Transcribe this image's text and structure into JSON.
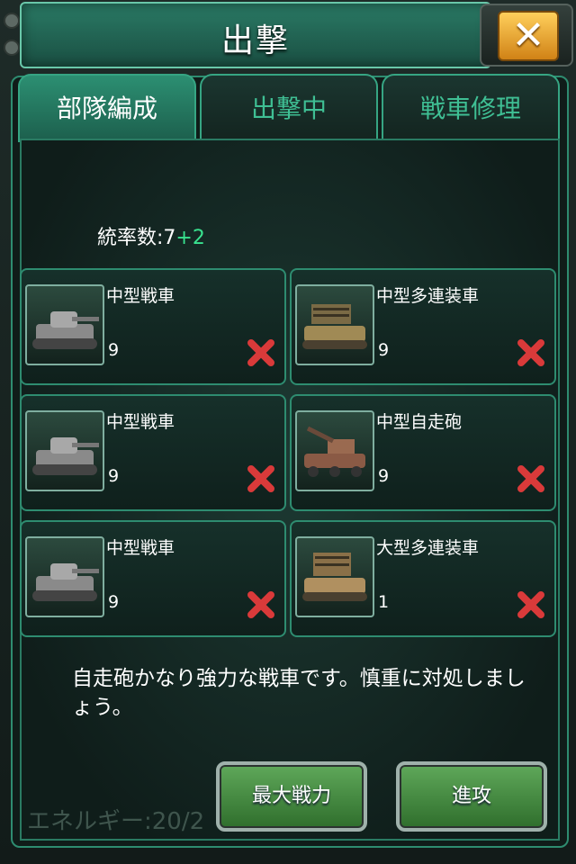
{
  "title": "出撃",
  "tabs": [
    {
      "label": "部隊編成",
      "active": true
    },
    {
      "label": "出撃中",
      "active": false
    },
    {
      "label": "戦車修理",
      "active": false
    }
  ],
  "leadership": {
    "label": "統率数:7",
    "bonus": "+2"
  },
  "units": [
    {
      "name": "中型戦車",
      "count": "9",
      "icon": "medium-tank-icon"
    },
    {
      "name": "中型多連装車",
      "count": "9",
      "icon": "rocket-launcher-vehicle-icon"
    },
    {
      "name": "中型戦車",
      "count": "9",
      "icon": "medium-tank-icon"
    },
    {
      "name": "中型自走砲",
      "count": "9",
      "icon": "self-propelled-gun-icon"
    },
    {
      "name": "中型戦車",
      "count": "9",
      "icon": "medium-tank-icon"
    },
    {
      "name": "大型多連装車",
      "count": "1",
      "icon": "rocket-launcher-vehicle-icon"
    }
  ],
  "description": "自走砲かなり強力な戦車です。慎重に対処しましょう。",
  "energy": "エネルギー:20/2",
  "buttons": {
    "max_power": "最大戦力",
    "attack": "進攻"
  },
  "colors": {
    "accent": "#2e8c70",
    "bonus": "#39e28f",
    "button": "#3f8a3b",
    "close": "#f0a12e"
  }
}
